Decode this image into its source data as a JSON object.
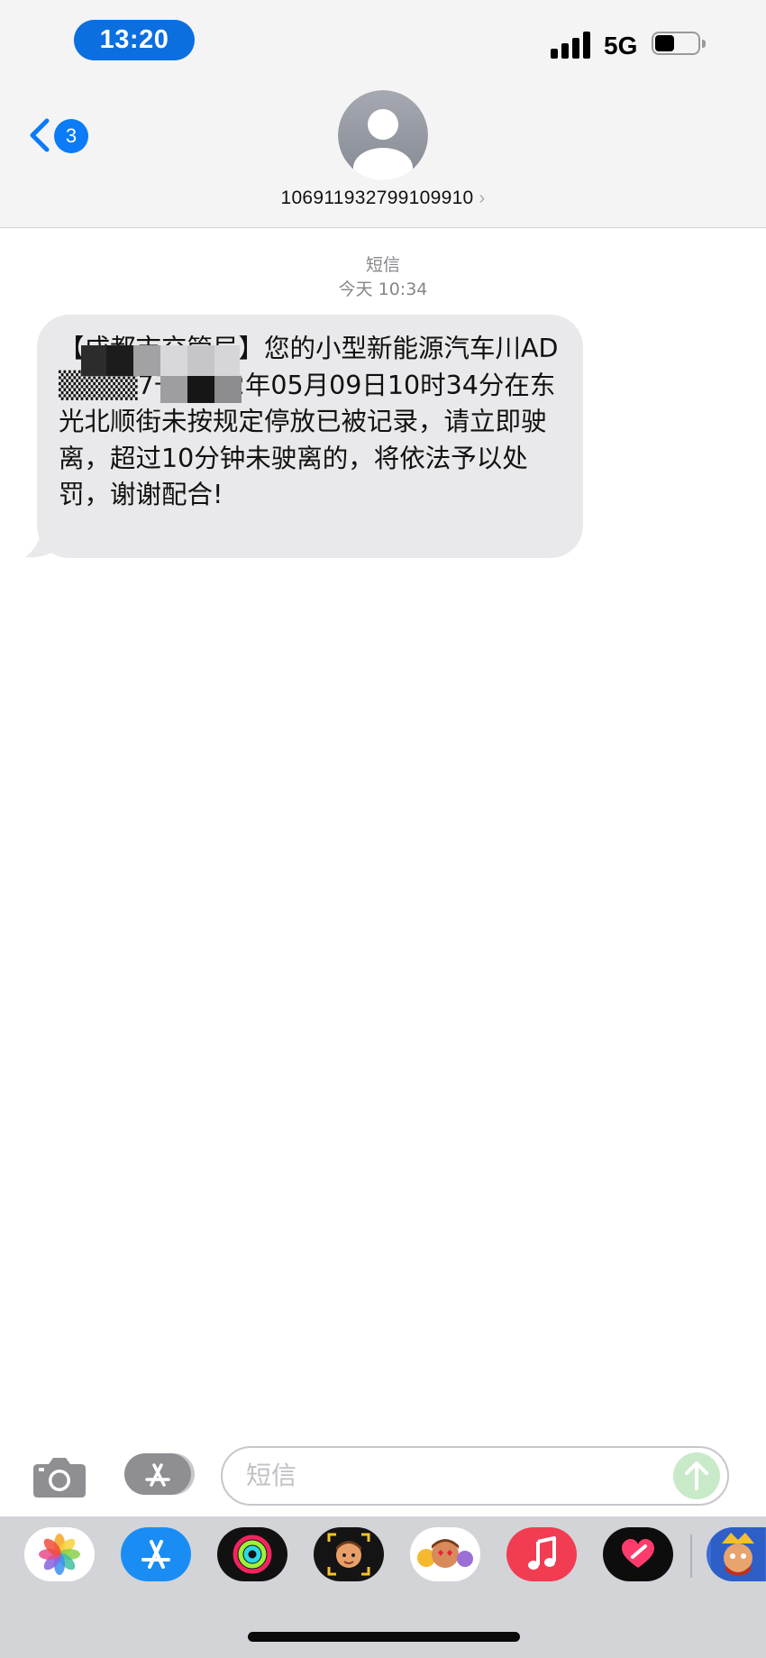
{
  "status_bar": {
    "time": "13:20",
    "network": "5G",
    "signal_bars": 4,
    "battery_level": 0.45
  },
  "header": {
    "back_badge_count": "3",
    "contact_name": "106911932799109910",
    "chevron_glyph": "›"
  },
  "conversation": {
    "message_type": "短信",
    "timestamp": "今天 10:34",
    "messages": [
      {
        "direction": "incoming",
        "text": "【成都市交管局】您的小型新能源汽车川AD▒▒▒▒7于2022年05月09日10时34分在东光北顺街未按规定停放已被记录，请立即驶离，超过10分钟未驶离的，将依法予以处罚，谢谢配合!"
      }
    ]
  },
  "compose": {
    "placeholder": "短信"
  },
  "app_drawer": {
    "apps": [
      "photos-app",
      "app-store-app",
      "activity-app",
      "memoji-app",
      "animoji-app",
      "music-app",
      "digital-touch-app",
      "game-app"
    ]
  },
  "colors": {
    "accent_blue": "#0b7bf7",
    "time_pill": "#0b6fe0",
    "bubble_gray": "#e9e9eb",
    "send_disabled_green": "#c9eac8",
    "drawer_bg": "#d3d4d8"
  }
}
